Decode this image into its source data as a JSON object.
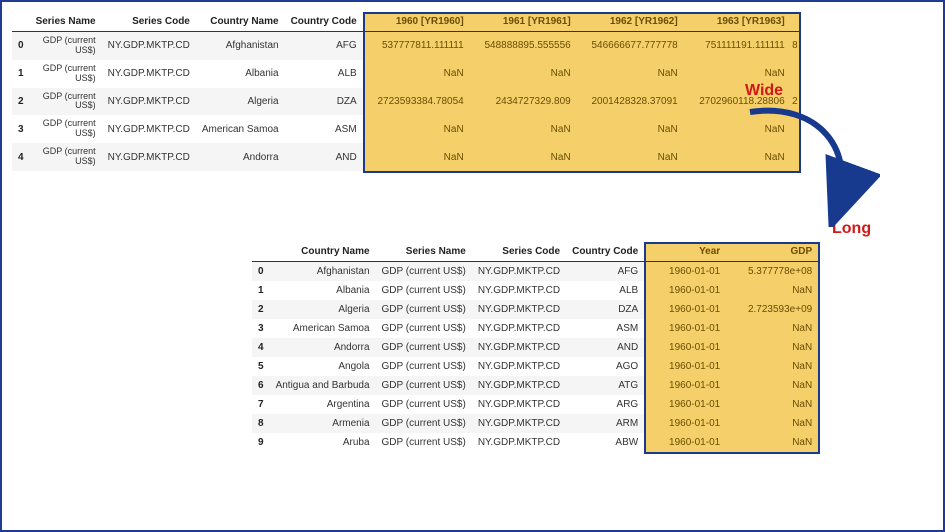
{
  "labels": {
    "wide": "Wide",
    "long": "Long"
  },
  "wide": {
    "headers": [
      "",
      "Series Name",
      "Series Code",
      "Country Name",
      "Country Code",
      "1960 [YR1960]",
      "1961 [YR1961]",
      "1962 [YR1962]",
      "1963 [YR1963]",
      ""
    ],
    "rows": [
      {
        "idx": "0",
        "series_name": "GDP (current US$)",
        "series_code": "NY.GDP.MKTP.CD",
        "country_name": "Afghanistan",
        "country_code": "AFG",
        "y1960": "537777811.111111",
        "y1961": "548888895.555556",
        "y1962": "546666677.777778",
        "y1963": "751111191.111111",
        "tail": "8"
      },
      {
        "idx": "1",
        "series_name": "GDP (current US$)",
        "series_code": "NY.GDP.MKTP.CD",
        "country_name": "Albania",
        "country_code": "ALB",
        "y1960": "NaN",
        "y1961": "NaN",
        "y1962": "NaN",
        "y1963": "NaN",
        "tail": ""
      },
      {
        "idx": "2",
        "series_name": "GDP (current US$)",
        "series_code": "NY.GDP.MKTP.CD",
        "country_name": "Algeria",
        "country_code": "DZA",
        "y1960": "2723593384.78054",
        "y1961": "2434727329.809",
        "y1962": "2001428328.37091",
        "y1963": "2702960118.28806",
        "tail": "2"
      },
      {
        "idx": "3",
        "series_name": "GDP (current US$)",
        "series_code": "NY.GDP.MKTP.CD",
        "country_name": "American Samoa",
        "country_code": "ASM",
        "y1960": "NaN",
        "y1961": "NaN",
        "y1962": "NaN",
        "y1963": "NaN",
        "tail": ""
      },
      {
        "idx": "4",
        "series_name": "GDP (current US$)",
        "series_code": "NY.GDP.MKTP.CD",
        "country_name": "Andorra",
        "country_code": "AND",
        "y1960": "NaN",
        "y1961": "NaN",
        "y1962": "NaN",
        "y1963": "NaN",
        "tail": ""
      }
    ]
  },
  "long": {
    "headers": [
      "",
      "Country Name",
      "Series Name",
      "Series Code",
      "Country Code",
      "Year",
      "GDP"
    ],
    "rows": [
      {
        "idx": "0",
        "country_name": "Afghanistan",
        "series_name": "GDP (current US$)",
        "series_code": "NY.GDP.MKTP.CD",
        "country_code": "AFG",
        "year": "1960-01-01",
        "gdp": "5.377778e+08"
      },
      {
        "idx": "1",
        "country_name": "Albania",
        "series_name": "GDP (current US$)",
        "series_code": "NY.GDP.MKTP.CD",
        "country_code": "ALB",
        "year": "1960-01-01",
        "gdp": "NaN"
      },
      {
        "idx": "2",
        "country_name": "Algeria",
        "series_name": "GDP (current US$)",
        "series_code": "NY.GDP.MKTP.CD",
        "country_code": "DZA",
        "year": "1960-01-01",
        "gdp": "2.723593e+09"
      },
      {
        "idx": "3",
        "country_name": "American Samoa",
        "series_name": "GDP (current US$)",
        "series_code": "NY.GDP.MKTP.CD",
        "country_code": "ASM",
        "year": "1960-01-01",
        "gdp": "NaN"
      },
      {
        "idx": "4",
        "country_name": "Andorra",
        "series_name": "GDP (current US$)",
        "series_code": "NY.GDP.MKTP.CD",
        "country_code": "AND",
        "year": "1960-01-01",
        "gdp": "NaN"
      },
      {
        "idx": "5",
        "country_name": "Angola",
        "series_name": "GDP (current US$)",
        "series_code": "NY.GDP.MKTP.CD",
        "country_code": "AGO",
        "year": "1960-01-01",
        "gdp": "NaN"
      },
      {
        "idx": "6",
        "country_name": "Antigua and Barbuda",
        "series_name": "GDP (current US$)",
        "series_code": "NY.GDP.MKTP.CD",
        "country_code": "ATG",
        "year": "1960-01-01",
        "gdp": "NaN"
      },
      {
        "idx": "7",
        "country_name": "Argentina",
        "series_name": "GDP (current US$)",
        "series_code": "NY.GDP.MKTP.CD",
        "country_code": "ARG",
        "year": "1960-01-01",
        "gdp": "NaN"
      },
      {
        "idx": "8",
        "country_name": "Armenia",
        "series_name": "GDP (current US$)",
        "series_code": "NY.GDP.MKTP.CD",
        "country_code": "ARM",
        "year": "1960-01-01",
        "gdp": "NaN"
      },
      {
        "idx": "9",
        "country_name": "Aruba",
        "series_name": "GDP (current US$)",
        "series_code": "NY.GDP.MKTP.CD",
        "country_code": "ABW",
        "year": "1960-01-01",
        "gdp": "NaN"
      }
    ]
  }
}
